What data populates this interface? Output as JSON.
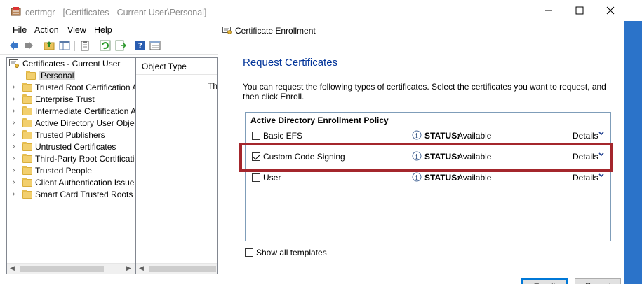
{
  "certmgr": {
    "title": "certmgr - [Certificates - Current User\\Personal]",
    "menu": [
      "File",
      "Action",
      "View",
      "Help"
    ],
    "tree": {
      "root": "Certificates - Current User",
      "items": [
        {
          "label": "Personal",
          "selected": true
        },
        {
          "label": "Trusted Root Certification Au"
        },
        {
          "label": "Enterprise Trust"
        },
        {
          "label": "Intermediate Certification Au"
        },
        {
          "label": "Active Directory User Object"
        },
        {
          "label": "Trusted Publishers"
        },
        {
          "label": "Untrusted Certificates"
        },
        {
          "label": "Third-Party Root Certification"
        },
        {
          "label": "Trusted People"
        },
        {
          "label": "Client Authentication Issuers"
        },
        {
          "label": "Smart Card Trusted Roots"
        }
      ]
    },
    "list": {
      "column_header": "Object Type",
      "truncated_text": "Th"
    }
  },
  "dialog": {
    "title": "Certificate Enrollment",
    "heading": "Request Certificates",
    "description": "You can request the following types of certificates. Select the certificates you want to request, and then click Enroll.",
    "policy_title": "Active Directory Enrollment Policy",
    "certificates": [
      {
        "name": "Basic EFS",
        "checked": false,
        "status_label": "STATUS:",
        "status": "Available",
        "details": "Details"
      },
      {
        "name": "Custom Code Signing",
        "checked": true,
        "status_label": "STATUS:",
        "status": "Available",
        "details": "Details"
      },
      {
        "name": "User",
        "checked": false,
        "status_label": "STATUS:",
        "status": "Available",
        "details": "Details"
      }
    ],
    "show_all_label": "Show all templates",
    "buttons": {
      "enroll": "Enroll",
      "cancel": "Cancel"
    }
  },
  "colors": {
    "heading": "#003399",
    "highlight": "#a4262c",
    "desktop": "#2b73c9"
  }
}
